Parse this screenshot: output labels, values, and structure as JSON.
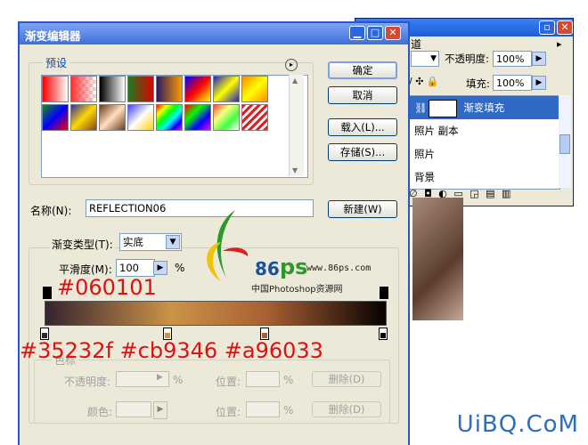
{
  "layers_panel": {
    "tab_label": "道",
    "opacity_label": "不透明度:",
    "opacity_value": "100%",
    "fill_label": "填充:",
    "fill_value": "100%",
    "lock_icons": "/ ✣ 🔒",
    "layers": [
      "渐变填充",
      "照片 副本",
      "照片",
      "背景"
    ],
    "selected_index": 0,
    "tool_icons": "∅ ◘ ◐ ▭ ◲ ▤ ▥"
  },
  "dialog": {
    "title": "渐变编辑器",
    "presets_label": "预设",
    "buttons": {
      "ok": "确定",
      "cancel": "取消",
      "load": "载入(L)...",
      "save": "存储(S)...",
      "new": "新建(W)"
    },
    "name_label": "名称(N):",
    "name_value": "REFLECTION06",
    "gradient_type_label": "渐变类型(T):",
    "gradient_type_value": "实底",
    "smoothness_label": "平滑度(M):",
    "smoothness_value": "100",
    "smoothness_unit": "%",
    "stops_group_label": "色标",
    "opacity_label": "不透明度:",
    "opacity_unit": "%",
    "location_label": "位置:",
    "location_unit": "%",
    "delete_label": "删除(D)",
    "color_label": "颜色:",
    "color_stops": [
      "#35232f",
      "#cb9346",
      "#a96033",
      "#060101"
    ]
  },
  "annotations": {
    "top": "#060101",
    "bottom": "#35232f #cb9346 #a96033"
  },
  "watermark": {
    "site": "www.86ps.com",
    "site_num": "86",
    "cn_name": "中国Photoshop资源网",
    "brand": "UiBQ.CoM"
  }
}
